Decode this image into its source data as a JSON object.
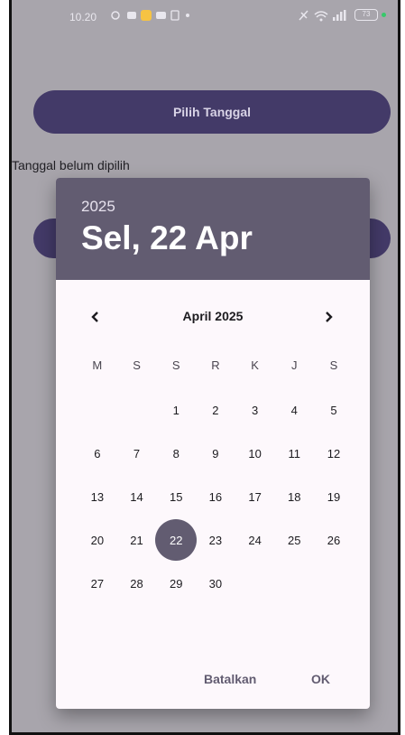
{
  "status_bar": {
    "time": "10.20",
    "battery": "73"
  },
  "background": {
    "pick_date_button": "Pilih Tanggal",
    "info_text": "Tanggal belum dipilih"
  },
  "dialog": {
    "year": "2025",
    "selected_date": "Sel, 22 Apr",
    "month_title": "April 2025",
    "weekdays": [
      "M",
      "S",
      "S",
      "R",
      "K",
      "J",
      "S"
    ],
    "leading_blanks": 2,
    "days": [
      "1",
      "2",
      "3",
      "4",
      "5",
      "6",
      "7",
      "8",
      "9",
      "10",
      "11",
      "12",
      "13",
      "14",
      "15",
      "16",
      "17",
      "18",
      "19",
      "20",
      "21",
      "22",
      "23",
      "24",
      "25",
      "26",
      "27",
      "28",
      "29",
      "30"
    ],
    "selected_day": "22",
    "cancel_label": "Batalkan",
    "ok_label": "OK"
  },
  "colors": {
    "accent": "#625c71",
    "button": "#433a68",
    "scrim": "#a8a5ac"
  }
}
